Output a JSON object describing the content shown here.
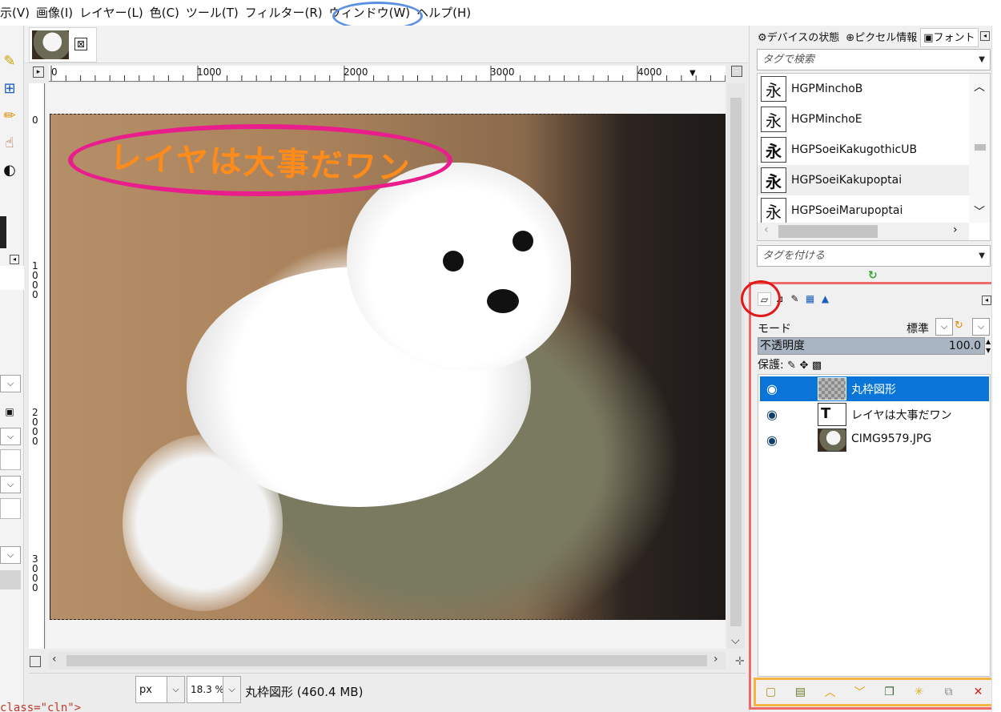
{
  "menu": [
    "示(V)",
    "画像(I)",
    "レイヤー(L)",
    "色(C)",
    "ツール(T)",
    "フィルター(R)",
    "ウィンドウ(W)",
    "ヘルプ(H)"
  ],
  "image_tab": {
    "close_glyph": "⊠"
  },
  "ruler_h": [
    "0",
    "1000",
    "2000",
    "3000",
    "4000"
  ],
  "ruler_v": [
    [
      "0"
    ],
    [
      "1",
      "0",
      "0",
      "0"
    ],
    [
      "2",
      "0",
      "0",
      "0"
    ],
    [
      "3",
      "0",
      "0",
      "0"
    ]
  ],
  "canvas": {
    "banner_text": "レイヤは大事だワン",
    "banner_color": "#ff8c1a",
    "banner_ring": "#e91e8c"
  },
  "status": {
    "unit": "px",
    "zoom": "18.3 %",
    "info": "丸枠図形 (460.4 MB)"
  },
  "dock": {
    "tabs": [
      "デバイスの状態",
      "ピクセル情報",
      "フォント"
    ],
    "tag_search_placeholder": "タグで検索",
    "tag_assign_placeholder": "タグを付ける",
    "fonts": [
      {
        "glyph": "永",
        "name": "HGPMinchoB"
      },
      {
        "glyph": "永",
        "name": "HGPMinchoE"
      },
      {
        "glyph": "永",
        "name": "HGPSoeiKakugothicUB"
      },
      {
        "glyph": "永",
        "name": "HGPSoeiKakupoptai"
      },
      {
        "glyph": "永",
        "name": "HGPSoeiMarupoptai"
      }
    ],
    "selected_font_index": 3
  },
  "layers": {
    "mode_label": "モード",
    "mode_value": "標準",
    "opacity_label": "不透明度",
    "opacity_value": "100.0",
    "protect_label": "保護:",
    "items": [
      {
        "name": "丸枠図形",
        "selected": true
      },
      {
        "name": "レイヤは大事だワン",
        "selected": false
      },
      {
        "name": "CIMG9579.JPG",
        "selected": false
      }
    ],
    "accent": "#0a74d8"
  },
  "bottom_code": "class=\"cln\">"
}
